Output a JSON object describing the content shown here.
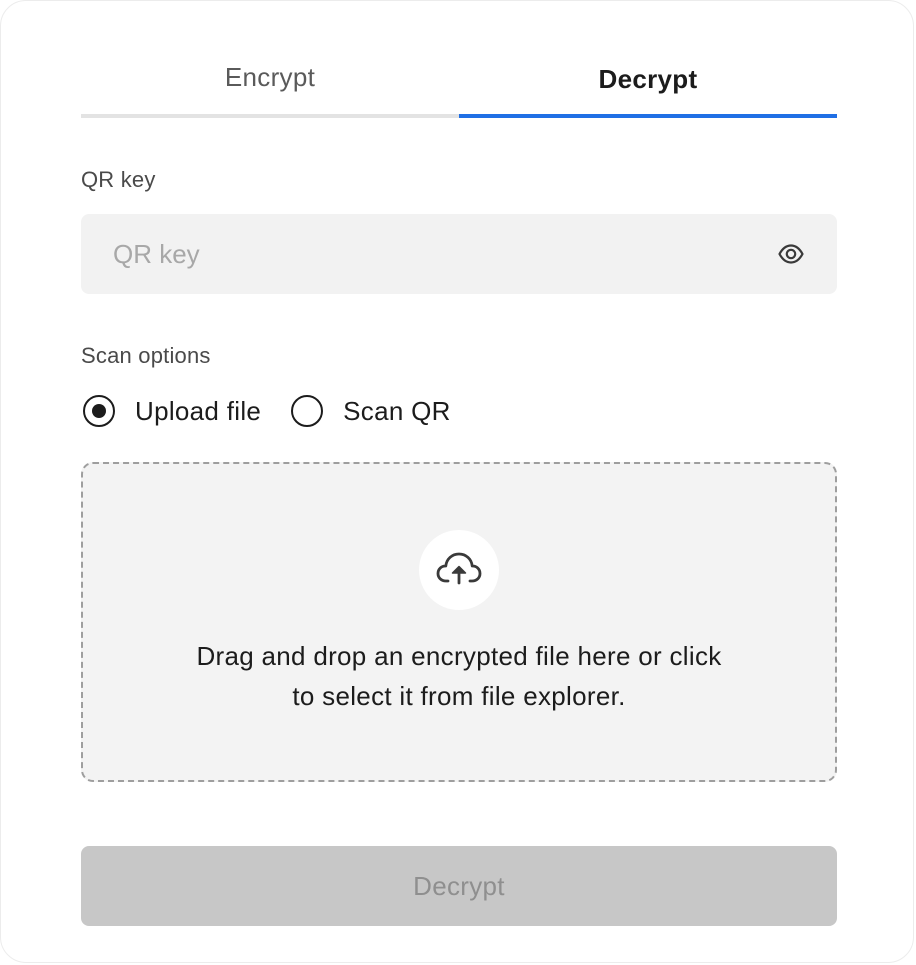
{
  "tabs": [
    {
      "label": "Encrypt",
      "active": false
    },
    {
      "label": "Decrypt",
      "active": true
    }
  ],
  "qr_key": {
    "label": "QR key",
    "placeholder": "QR key",
    "value": "",
    "toggle_icon": "eye-icon"
  },
  "scan_options": {
    "label": "Scan options",
    "options": [
      {
        "label": "Upload file",
        "selected": true
      },
      {
        "label": "Scan QR",
        "selected": false
      }
    ]
  },
  "dropzone": {
    "icon": "cloud-upload-icon",
    "text_line1": "Drag and drop an encrypted file here or click",
    "text_line2": "to select it from file explorer."
  },
  "submit": {
    "label": "Decrypt",
    "disabled": true
  },
  "colors": {
    "accent": "#1f6fe5",
    "input_bg": "#f2f2f2",
    "disabled_button_bg": "#c7c7c7",
    "disabled_button_text": "#8f8f8f"
  }
}
